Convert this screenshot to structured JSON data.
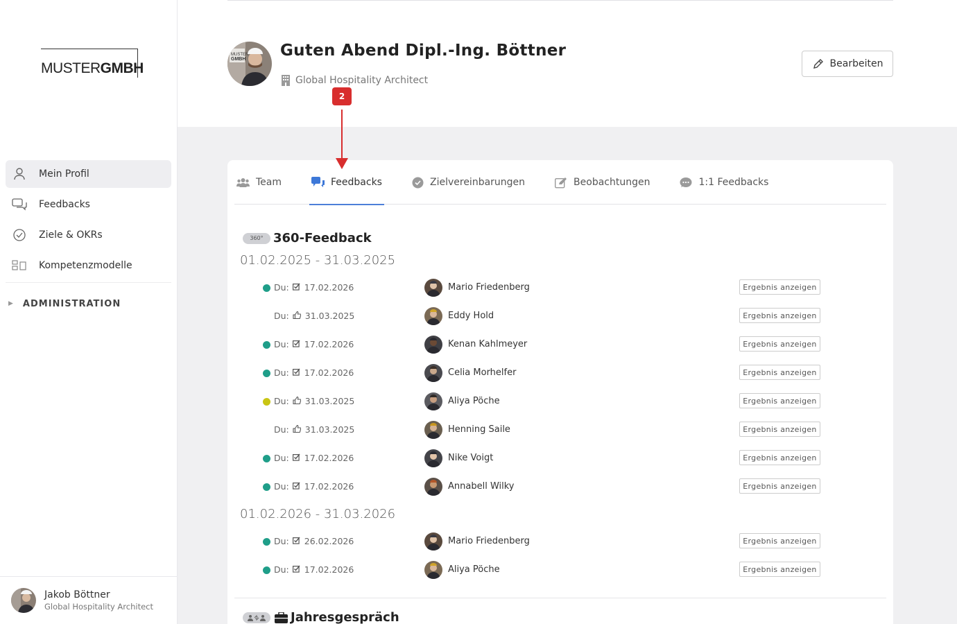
{
  "sidebar": {
    "logo": {
      "left": "MUSTER",
      "right": "GMBH"
    },
    "items": [
      {
        "label": "Mein Profil",
        "icon": "user-icon",
        "active": true
      },
      {
        "label": "Feedbacks",
        "icon": "chat-bubbles-icon"
      },
      {
        "label": "Ziele & OKRs",
        "icon": "check-circle-icon"
      },
      {
        "label": "Kompetenzmodelle",
        "icon": "grid-icon"
      }
    ],
    "admin_label": "ADMINISTRATION",
    "user": {
      "name": "Jakob Böttner",
      "role": "Global Hospitality Architect"
    }
  },
  "header": {
    "greeting": "Guten Abend Dipl.-Ing. Böttner",
    "subtitle": "Global Hospitality Architect",
    "edit_label": "Bearbeiten"
  },
  "annotation": {
    "badge": "2",
    "color": "#d82e2e"
  },
  "tabs": [
    {
      "label": "Team",
      "icon": "team-icon"
    },
    {
      "label": "Feedbacks",
      "icon": "feedback-bubbles-icon",
      "active": true
    },
    {
      "label": "Zielvereinbarungen",
      "icon": "check-circle-icon"
    },
    {
      "label": "Beobachtungen",
      "icon": "edit-icon"
    },
    {
      "label": "1:1 Feedbacks",
      "icon": "comment-icon"
    }
  ],
  "section": {
    "badge": "360°",
    "title": "360-Feedback",
    "next_title": "Jahresgespräch",
    "periods": [
      {
        "range": "01.02.2025 - 31.03.2025",
        "rows": [
          {
            "status": "green",
            "du": "Du:",
            "kind": "check",
            "date": "17.02.2026",
            "name": "Mario Friedenberg",
            "button": "Ergebnis anzeigen"
          },
          {
            "status": "none",
            "du": "Du:",
            "kind": "thumb",
            "date": "31.03.2025",
            "name": "Eddy Hold",
            "button": "Ergebnis anzeigen"
          },
          {
            "status": "green",
            "du": "Du:",
            "kind": "check",
            "date": "17.02.2026",
            "name": "Kenan Kahlmeyer",
            "button": "Ergebnis anzeigen"
          },
          {
            "status": "green",
            "du": "Du:",
            "kind": "check",
            "date": "17.02.2026",
            "name": "Celia Morhelfer",
            "button": "Ergebnis anzeigen"
          },
          {
            "status": "yellow",
            "du": "Du:",
            "kind": "thumb",
            "date": "31.03.2025",
            "name": "Aliya Pöche",
            "button": "Ergebnis anzeigen"
          },
          {
            "status": "none",
            "du": "Du:",
            "kind": "thumb",
            "date": "31.03.2025",
            "name": "Henning Saile",
            "button": "Ergebnis anzeigen"
          },
          {
            "status": "green",
            "du": "Du:",
            "kind": "check",
            "date": "17.02.2026",
            "name": "Nike Voigt",
            "button": "Ergebnis anzeigen"
          },
          {
            "status": "green",
            "du": "Du:",
            "kind": "check",
            "date": "17.02.2026",
            "name": "Annabell Wilky",
            "button": "Ergebnis anzeigen"
          }
        ]
      },
      {
        "range": "01.02.2026 - 31.03.2026",
        "rows": [
          {
            "status": "green",
            "du": "Du:",
            "kind": "check",
            "date": "26.02.2026",
            "name": "Mario Friedenberg",
            "button": "Ergebnis anzeigen"
          },
          {
            "status": "green",
            "du": "Du:",
            "kind": "check",
            "date": "17.02.2026",
            "name": "Aliya Pöche",
            "button": "Ergebnis anzeigen"
          }
        ]
      }
    ]
  },
  "colors": {
    "green": "#1f9e89",
    "yellow": "#c9c514",
    "accent": "#4d7fd8",
    "annotation": "#d82e2e"
  }
}
